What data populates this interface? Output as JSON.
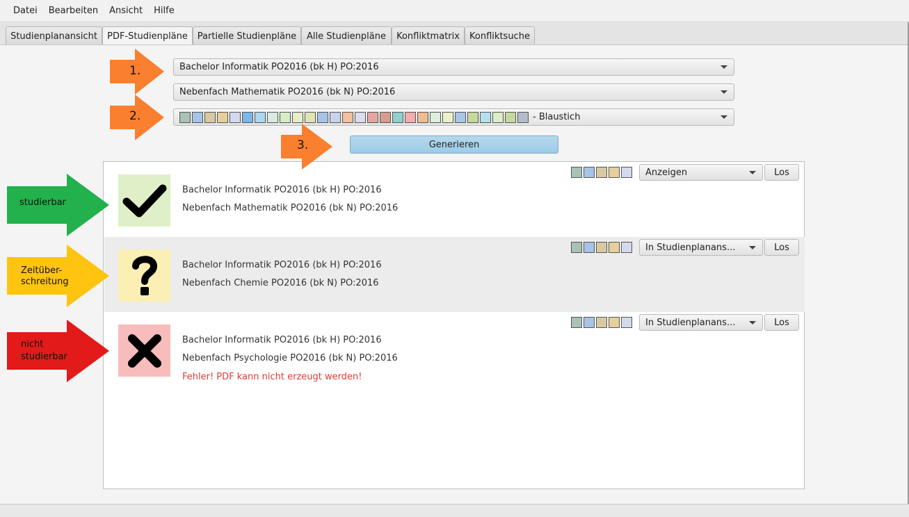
{
  "menu": [
    "Datei",
    "Bearbeiten",
    "Ansicht",
    "Hilfe"
  ],
  "tabs": [
    {
      "label": "Studienplanansicht",
      "active": false
    },
    {
      "label": "PDF-Studienpläne",
      "active": true
    },
    {
      "label": "Partielle Studienpläne",
      "active": false
    },
    {
      "label": "Alle Studienpläne",
      "active": false
    },
    {
      "label": "Konfliktmatrix",
      "active": false
    },
    {
      "label": "Konfliktsuche",
      "active": false
    }
  ],
  "form": {
    "major_select": "Bachelor Informatik PO2016 (bk H) PO:2016",
    "minor_select": "Nebenfach Mathematik PO2016 (bk N) PO:2016",
    "color_scheme_label": "- Blaustich",
    "color_scheme_swatches": [
      "#a9c2b6",
      "#a6c4e6",
      "#d9c9a3",
      "#e6cf9c",
      "#d4d9ee",
      "#7ab7ea",
      "#aed6f0",
      "#d9ebe0",
      "#d4eec8",
      "#e8eecc",
      "#dfe4b6",
      "#a6c4e6",
      "#c9d3ec",
      "#f2c09c",
      "#dcdcec",
      "#e3a6a2",
      "#d79c92",
      "#8fcfcc",
      "#f0aeae",
      "#f0bc92",
      "#dfeedd",
      "#eaf2cc",
      "#a8c6e6",
      "#c8d89c",
      "#b6e0ee",
      "#dcedc8",
      "#c6d8a0",
      "#b4bccc"
    ],
    "generate_button": "Generieren"
  },
  "results": [
    {
      "status": "studierbar",
      "line1": "Bachelor Informatik PO2016 (bk H) PO:2016",
      "line2": "Nebenfach Mathematik PO2016 (bk N) PO:2016",
      "error": "",
      "action": "Anzeigen",
      "go": "Los",
      "box_color": "#dff0c8",
      "swatches": [
        "#a9c2b6",
        "#a6c4e6",
        "#d9c9a3",
        "#e6cf9c",
        "#d4d9ee"
      ]
    },
    {
      "status": "zeitueberschreitung",
      "line1": "Bachelor Informatik PO2016 (bk H) PO:2016",
      "line2": "Nebenfach Chemie PO2016 (bk N) PO:2016",
      "error": "",
      "action": "In Studienplanans...",
      "go": "Los",
      "box_color": "#fcefb4",
      "swatches": [
        "#a9c2b6",
        "#a6c4e6",
        "#d9c9a3",
        "#e6cf9c",
        "#d4d9ee"
      ]
    },
    {
      "status": "nicht-studierbar",
      "line1": "Bachelor Informatik PO2016 (bk H) PO:2016",
      "line2": "Nebenfach Psychologie PO2016 (bk N) PO:2016",
      "error": "Fehler! PDF kann nicht erzeugt werden!",
      "action": "In Studienplanans...",
      "go": "Los",
      "box_color": "#f8bcbc",
      "swatches": [
        "#a9c2b6",
        "#a6c4e6",
        "#d9c9a3",
        "#e6cf9c",
        "#d4d9ee"
      ]
    }
  ],
  "annotations": {
    "step1": "1.",
    "step2": "2.",
    "step3": "3.",
    "green": "studierbar",
    "yellow1": "Zeitüber-",
    "yellow2": "schreitung",
    "red1": "nicht",
    "red2": "studierbar",
    "colors": {
      "orange": "#fa7f2e",
      "green": "#22b14c",
      "yellow": "#fec40f",
      "red": "#e31a1a"
    }
  }
}
